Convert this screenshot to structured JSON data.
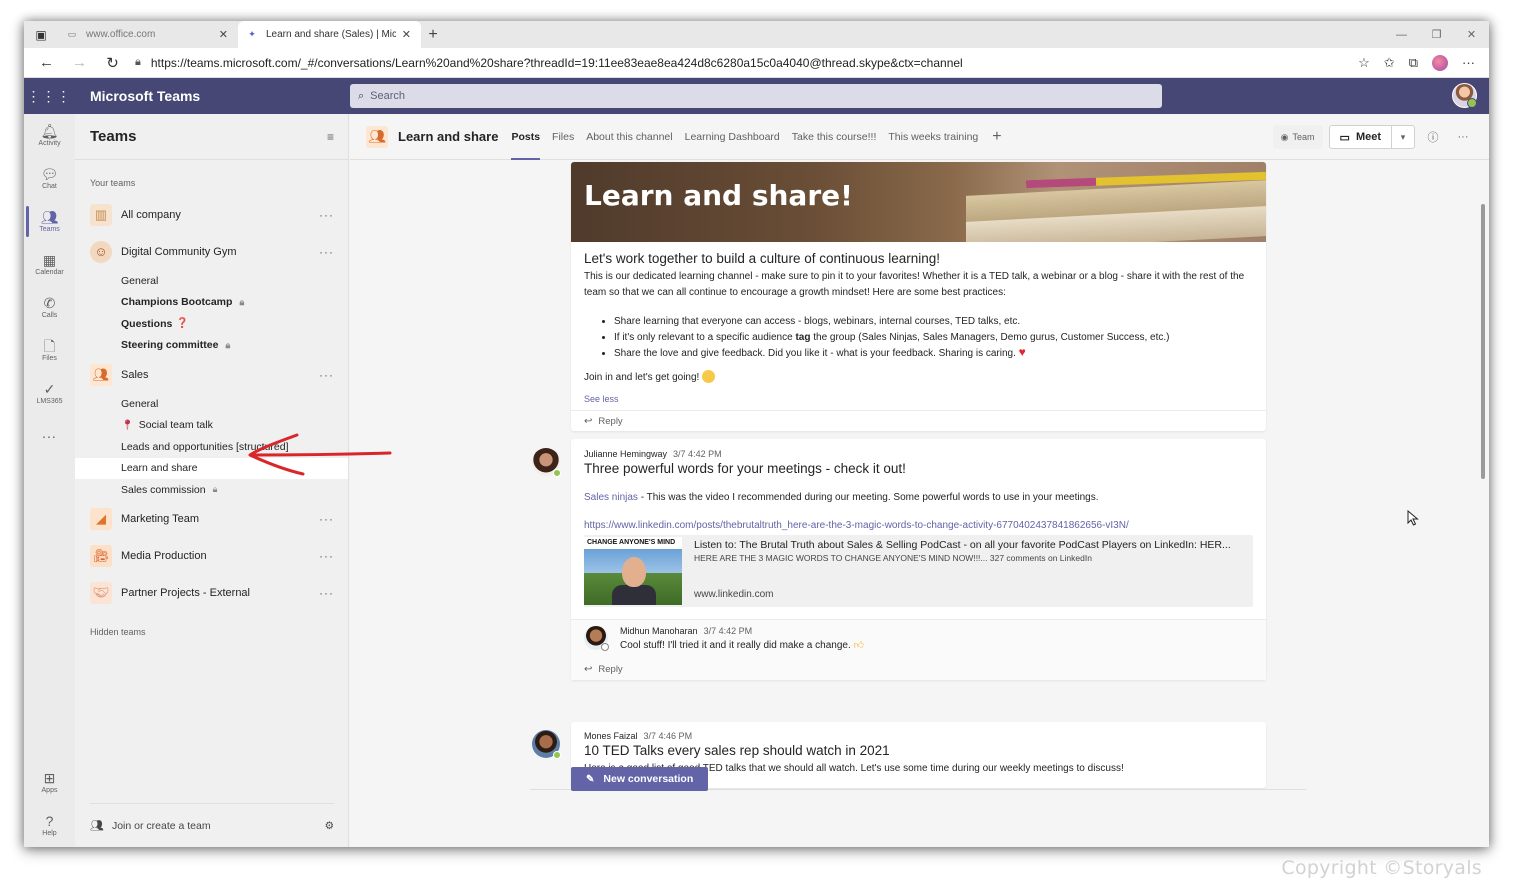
{
  "browser": {
    "tabs": [
      {
        "title": "www.office.com",
        "active": false
      },
      {
        "title": "Learn and share (Sales) | Microso",
        "active": true
      }
    ],
    "url": "https://teams.microsoft.com/_#/conversations/Learn%20and%20share?threadId=19:11ee83eae8ea424d8c6280a15c0a4040@thread.skype&ctx=channel"
  },
  "header": {
    "app_name": "Microsoft Teams",
    "search_placeholder": "Search"
  },
  "rail": {
    "items": [
      {
        "label": "Activity",
        "icon": "bell-icon"
      },
      {
        "label": "Chat",
        "icon": "chat-icon"
      },
      {
        "label": "Teams",
        "icon": "teams-icon"
      },
      {
        "label": "Calendar",
        "icon": "calendar-icon"
      },
      {
        "label": "Calls",
        "icon": "phone-icon"
      },
      {
        "label": "Files",
        "icon": "file-icon"
      },
      {
        "label": "LMS365",
        "icon": "check-circle-icon"
      }
    ],
    "more": "...",
    "bottom": [
      {
        "label": "Apps",
        "icon": "apps-icon"
      },
      {
        "label": "Help",
        "icon": "help-icon"
      }
    ]
  },
  "teams_pane": {
    "title": "Teams",
    "section_label": "Your teams",
    "teams": [
      {
        "name": "All company",
        "channels": []
      },
      {
        "name": "Digital Community Gym",
        "channels": [
          {
            "name": "General"
          },
          {
            "name": "Champions Bootcamp"
          },
          {
            "name": "Questions"
          },
          {
            "name": "Steering committee"
          }
        ]
      },
      {
        "name": "Sales",
        "channels": [
          {
            "name": "General"
          },
          {
            "name": "Social team talk"
          },
          {
            "name": "Leads and opportunities [structured]"
          },
          {
            "name": "Learn and share"
          },
          {
            "name": "Sales commission"
          }
        ]
      },
      {
        "name": "Marketing Team",
        "channels": []
      },
      {
        "name": "Media Production",
        "channels": []
      },
      {
        "name": "Partner Projects - External",
        "channels": []
      }
    ],
    "hidden_label": "Hidden teams",
    "join_label": "Join or create a team"
  },
  "channel": {
    "name": "Learn and share",
    "tabs": [
      "Posts",
      "Files",
      "About this channel",
      "Learning Dashboard",
      "Take this course!!!",
      "This weeks training"
    ],
    "team_label": "Team",
    "meet_label": "Meet"
  },
  "posts": {
    "p1": {
      "banner_title": "Learn and share!",
      "subject": "Let's work together to build a culture of continuous learning!",
      "text": "This is our dedicated learning channel - make sure to pin it to your favorites! Whether it is a TED talk, a webinar or a blog - share it with the rest of the team so that we can all continue to encourage a growth mindset! Here are some best practices:",
      "bullets": [
        "Share learning that everyone can access - blogs, webinars, internal courses, TED talks, etc.",
        "If it's only relevant to a specific audience ",
        "Share the love and give feedback. Did you like it - what is your feedback. Sharing is caring."
      ],
      "bullet2_bold": "tag",
      "bullet2_rest": " the group (Sales Ninjas, Sales Managers, Demo gurus, Customer Success, etc.)",
      "closing": "Join in and let's get going!",
      "see_less": "See less",
      "reply": "Reply"
    },
    "p2": {
      "author": "Julianne Hemingway",
      "time": "3/7 4:42 PM",
      "subject": "Three powerful words for your meetings - check it out!",
      "mention": "Sales ninjas",
      "text": " - This was the video I recommended during our meeting. Some powerful words to use in your meetings.",
      "link": "https://www.linkedin.com/posts/thebrutaltruth_here-are-the-3-magic-words-to-change-activity-6770402437841862656-vI3N/",
      "preview_caption": "CHANGE ANYONE'S MIND",
      "preview_title": "Listen to: The Brutal Truth about Sales & Selling PodCast - on all your favorite PodCast Players on LinkedIn: HER...",
      "preview_desc": "HERE ARE THE 3 MAGIC WORDS TO CHANGE ANYONE'S MIND NOW!!!... 327 comments on LinkedIn",
      "preview_domain": "www.linkedin.com",
      "reply_author": "Midhun Manoharan",
      "reply_time": "3/7 4:42 PM",
      "reply_text": "Cool stuff! I'll tried it and it really did make a change.",
      "reply": "Reply"
    },
    "p3": {
      "author": "Mones Faizal",
      "time": "3/7 4:46 PM",
      "subject": "10 TED Talks every sales rep should watch in 2021",
      "text": "Here is a good list of good TED talks that we should all watch. Let's use some time during our weekly meetings to discuss!"
    }
  },
  "new_conversation": "New conversation",
  "copyright": "Copyright ©Storyals",
  "colors": {
    "brand": "#464775",
    "accent": "#6264a7",
    "annotation_arrow": "#d9262a"
  }
}
